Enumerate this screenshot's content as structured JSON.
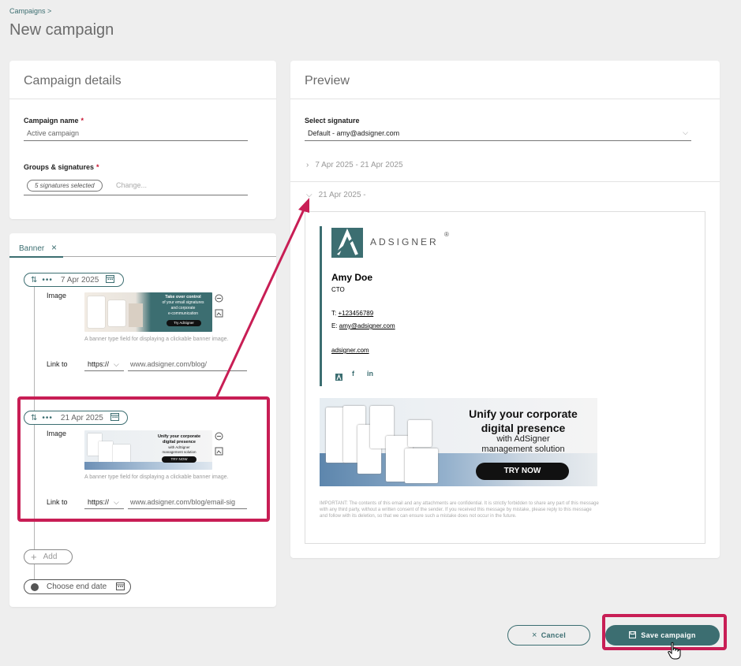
{
  "header": {
    "breadcrumb": "Campaigns >",
    "title": "New campaign"
  },
  "details": {
    "title": "Campaign details",
    "name_label": "Campaign name",
    "name_value": "Active campaign",
    "groups_label": "Groups & signatures",
    "signatures_chip": "5 signatures selected",
    "change_link": "Change...",
    "required_mark": "*"
  },
  "banner": {
    "tab_label": "Banner",
    "tab_close": "×",
    "entries": [
      {
        "date": "7 Apr 2025",
        "image_label": "Image",
        "help_text": "A banner type field for displaying a clickable banner image.",
        "link_label": "Link to",
        "protocol": "https://",
        "url": "www.adsigner.com/blog/",
        "thumb_title": "Take over control",
        "thumb_sub1": "of your email signatures",
        "thumb_sub2": "and corporate",
        "thumb_sub3": "e-communication",
        "thumb_cta": "Try AdSigner"
      },
      {
        "date": "21 Apr 2025",
        "image_label": "Image",
        "help_text": "A banner type field for displaying a clickable banner image.",
        "link_label": "Link to",
        "protocol": "https://",
        "url": "www.adsigner.com/blog/email-sig",
        "thumb_title": "Unify your corporate",
        "thumb_title2": "digital presence",
        "thumb_sub1": "with AdSigner",
        "thumb_sub2": "management solution",
        "thumb_cta": "TRY NOW"
      }
    ],
    "add_label": "Add",
    "end_date_label": "Choose end date"
  },
  "preview": {
    "title": "Preview",
    "select_label": "Select signature",
    "select_value": "Default - amy@adsigner.com",
    "range1": "7 Apr 2025 - 21 Apr 2025",
    "range2": "21 Apr 2025 -",
    "signature": {
      "brand": "ADSIGNER",
      "registered": "®",
      "name": "Amy Doe",
      "role": "CTO",
      "phone_label": "T:",
      "phone": "+123456789",
      "email_label": "E:",
      "email": "amy@adsigner.com",
      "website": "adsigner.com"
    },
    "banner": {
      "title_line1": "Unify your corporate",
      "title_line2": "digital presence",
      "sub_line1": "with AdSigner",
      "sub_line2": "management solution",
      "cta": "TRY NOW"
    },
    "disclaimer": "IMPORTANT: The contents of this email and any attachments are confidential. It is strictly forbidden to share any part of this message with any third party, without a written consent of the sender. If you received this message by mistake, please reply to this message and follow with its deletion, so that we can ensure such a mistake does not occur in the future."
  },
  "actions": {
    "cancel": "Cancel",
    "save": "Save campaign"
  },
  "colors": {
    "accent": "#3c6e71",
    "highlight": "#c81e55",
    "required": "#c8102e"
  }
}
